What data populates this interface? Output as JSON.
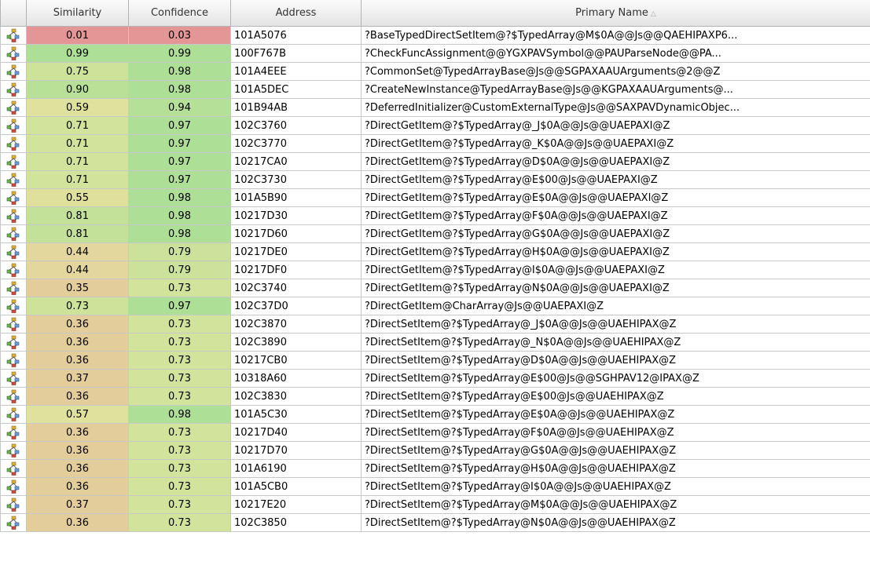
{
  "colors": {
    "red": "#e49595",
    "green": "#aedf97",
    "yellow_green": "#cde39a",
    "yellow": "#dfe29d",
    "tan": "#e3cd9b"
  },
  "header": {
    "icon_col": "",
    "similarity": "Similarity",
    "confidence": "Confidence",
    "address": "Address",
    "primary_name": "Primary Name",
    "sort_indicator": "△"
  },
  "row_icon": "function-graph-icon",
  "rows": [
    {
      "similarity": "0.01",
      "sim_color": "#e49595",
      "confidence": "0.03",
      "conf_color": "#e49595",
      "address": "101A5076",
      "name": "?BaseTypedDirectSetItem@?$TypedArray@M$0A@@Js@@QAEHIPAXP6..."
    },
    {
      "similarity": "0.99",
      "sim_color": "#aedf97",
      "confidence": "0.99",
      "conf_color": "#aedf97",
      "address": "100F767B",
      "name": "?CheckFuncAssignment@@YGXPAVSymbol@@PAUParseNode@@PA..."
    },
    {
      "similarity": "0.75",
      "sim_color": "#cde39a",
      "confidence": "0.98",
      "conf_color": "#aedf97",
      "address": "101A4EEE",
      "name": "?CommonSet@TypedArrayBase@Js@@SGPAXAAUArguments@2@@Z"
    },
    {
      "similarity": "0.90",
      "sim_color": "#b9e097",
      "confidence": "0.98",
      "conf_color": "#aedf97",
      "address": "101A5DEC",
      "name": "?CreateNewInstance@TypedArrayBase@Js@@KGPAXAAUArguments@..."
    },
    {
      "similarity": "0.59",
      "sim_color": "#dfe29d",
      "confidence": "0.94",
      "conf_color": "#b4e097",
      "address": "101B94AB",
      "name": "?DeferredInitializer@CustomExternalType@Js@@SAXPAVDynamicObjec..."
    },
    {
      "similarity": "0.71",
      "sim_color": "#d2e39b",
      "confidence": "0.97",
      "conf_color": "#aedf97",
      "address": "102C3760",
      "name": "?DirectGetItem@?$TypedArray@_J$0A@@Js@@UAEPAXI@Z"
    },
    {
      "similarity": "0.71",
      "sim_color": "#d2e39b",
      "confidence": "0.97",
      "conf_color": "#aedf97",
      "address": "102C3770",
      "name": "?DirectGetItem@?$TypedArray@_K$0A@@Js@@UAEPAXI@Z"
    },
    {
      "similarity": "0.71",
      "sim_color": "#d2e39b",
      "confidence": "0.97",
      "conf_color": "#aedf97",
      "address": "10217CA0",
      "name": "?DirectGetItem@?$TypedArray@D$0A@@Js@@UAEPAXI@Z"
    },
    {
      "similarity": "0.71",
      "sim_color": "#d2e39b",
      "confidence": "0.97",
      "conf_color": "#aedf97",
      "address": "102C3730",
      "name": "?DirectGetItem@?$TypedArray@E$00@Js@@UAEPAXI@Z"
    },
    {
      "similarity": "0.55",
      "sim_color": "#e0e09d",
      "confidence": "0.98",
      "conf_color": "#aedf97",
      "address": "101A5B90",
      "name": "?DirectGetItem@?$TypedArray@E$0A@@Js@@UAEPAXI@Z"
    },
    {
      "similarity": "0.81",
      "sim_color": "#c3e199",
      "confidence": "0.98",
      "conf_color": "#aedf97",
      "address": "10217D30",
      "name": "?DirectGetItem@?$TypedArray@F$0A@@Js@@UAEPAXI@Z"
    },
    {
      "similarity": "0.81",
      "sim_color": "#c3e199",
      "confidence": "0.98",
      "conf_color": "#aedf97",
      "address": "10217D60",
      "name": "?DirectGetItem@?$TypedArray@G$0A@@Js@@UAEPAXI@Z"
    },
    {
      "similarity": "0.44",
      "sim_color": "#e3d79d",
      "confidence": "0.79",
      "conf_color": "#cce29a",
      "address": "10217DE0",
      "name": "?DirectGetItem@?$TypedArray@H$0A@@Js@@UAEPAXI@Z"
    },
    {
      "similarity": "0.44",
      "sim_color": "#e3d79d",
      "confidence": "0.79",
      "conf_color": "#cce29a",
      "address": "10217DF0",
      "name": "?DirectGetItem@?$TypedArray@I$0A@@Js@@UAEPAXI@Z"
    },
    {
      "similarity": "0.35",
      "sim_color": "#e3cd9b",
      "confidence": "0.73",
      "conf_color": "#d2e39b",
      "address": "102C3740",
      "name": "?DirectGetItem@?$TypedArray@N$0A@@Js@@UAEPAXI@Z"
    },
    {
      "similarity": "0.73",
      "sim_color": "#cde39a",
      "confidence": "0.97",
      "conf_color": "#aedf97",
      "address": "102C37D0",
      "name": "?DirectGetItem@CharArray@Js@@UAEPAXI@Z"
    },
    {
      "similarity": "0.36",
      "sim_color": "#e3cd9b",
      "confidence": "0.73",
      "conf_color": "#d2e39b",
      "address": "102C3870",
      "name": "?DirectSetItem@?$TypedArray@_J$0A@@Js@@UAEHIPAX@Z"
    },
    {
      "similarity": "0.36",
      "sim_color": "#e3cd9b",
      "confidence": "0.73",
      "conf_color": "#d2e39b",
      "address": "102C3890",
      "name": "?DirectSetItem@?$TypedArray@_N$0A@@Js@@UAEHIPAX@Z"
    },
    {
      "similarity": "0.36",
      "sim_color": "#e3cd9b",
      "confidence": "0.73",
      "conf_color": "#d2e39b",
      "address": "10217CB0",
      "name": "?DirectSetItem@?$TypedArray@D$0A@@Js@@UAEHIPAX@Z"
    },
    {
      "similarity": "0.37",
      "sim_color": "#e3cd9b",
      "confidence": "0.73",
      "conf_color": "#d2e39b",
      "address": "10318A60",
      "name": "?DirectSetItem@?$TypedArray@E$00@Js@@SGHPAV12@IPAX@Z"
    },
    {
      "similarity": "0.36",
      "sim_color": "#e3cd9b",
      "confidence": "0.73",
      "conf_color": "#d2e39b",
      "address": "102C3830",
      "name": "?DirectSetItem@?$TypedArray@E$00@Js@@UAEHIPAX@Z"
    },
    {
      "similarity": "0.57",
      "sim_color": "#dfe29d",
      "confidence": "0.98",
      "conf_color": "#aedf97",
      "address": "101A5C30",
      "name": "?DirectSetItem@?$TypedArray@E$0A@@Js@@UAEHIPAX@Z"
    },
    {
      "similarity": "0.36",
      "sim_color": "#e3cd9b",
      "confidence": "0.73",
      "conf_color": "#d2e39b",
      "address": "10217D40",
      "name": "?DirectSetItem@?$TypedArray@F$0A@@Js@@UAEHIPAX@Z"
    },
    {
      "similarity": "0.36",
      "sim_color": "#e3cd9b",
      "confidence": "0.73",
      "conf_color": "#d2e39b",
      "address": "10217D70",
      "name": "?DirectSetItem@?$TypedArray@G$0A@@Js@@UAEHIPAX@Z"
    },
    {
      "similarity": "0.36",
      "sim_color": "#e3cd9b",
      "confidence": "0.73",
      "conf_color": "#d2e39b",
      "address": "101A6190",
      "name": "?DirectSetItem@?$TypedArray@H$0A@@Js@@UAEHIPAX@Z"
    },
    {
      "similarity": "0.36",
      "sim_color": "#e3cd9b",
      "confidence": "0.73",
      "conf_color": "#d2e39b",
      "address": "101A5CB0",
      "name": "?DirectSetItem@?$TypedArray@I$0A@@Js@@UAEHIPAX@Z"
    },
    {
      "similarity": "0.37",
      "sim_color": "#e3cd9b",
      "confidence": "0.73",
      "conf_color": "#d2e39b",
      "address": "10217E20",
      "name": "?DirectSetItem@?$TypedArray@M$0A@@Js@@UAEHIPAX@Z"
    },
    {
      "similarity": "0.36",
      "sim_color": "#e3cd9b",
      "confidence": "0.73",
      "conf_color": "#d2e39b",
      "address": "102C3850",
      "name": "?DirectSetItem@?$TypedArray@N$0A@@Js@@UAEHIPAX@Z"
    }
  ]
}
